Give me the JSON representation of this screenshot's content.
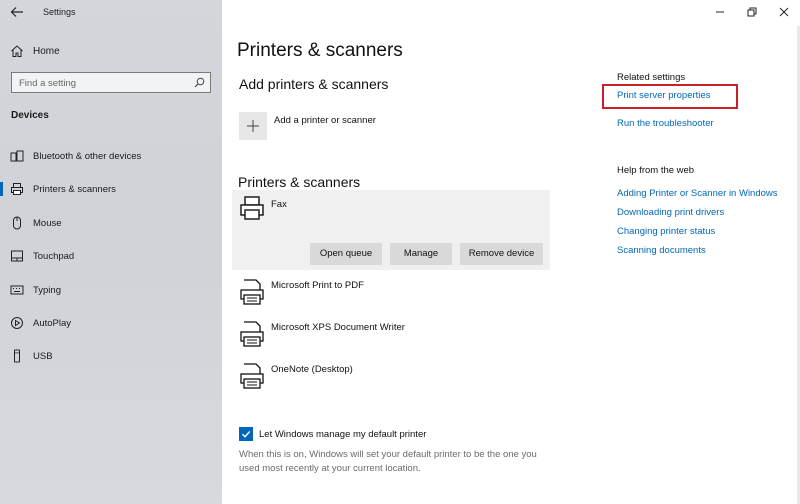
{
  "window": {
    "app_title": "Settings",
    "controls": [
      "minimize-icon",
      "restore-icon",
      "close-icon"
    ]
  },
  "sidebar": {
    "home_label": "Home",
    "search_placeholder": "Find a setting",
    "section_label": "Devices",
    "items": [
      {
        "label": "Bluetooth & other devices",
        "icon": "bluetooth-devices-icon",
        "active": false
      },
      {
        "label": "Printers & scanners",
        "icon": "printer-icon",
        "active": true
      },
      {
        "label": "Mouse",
        "icon": "mouse-icon",
        "active": false
      },
      {
        "label": "Touchpad",
        "icon": "touchpad-icon",
        "active": false
      },
      {
        "label": "Typing",
        "icon": "keyboard-icon",
        "active": false
      },
      {
        "label": "AutoPlay",
        "icon": "autoplay-icon",
        "active": false
      },
      {
        "label": "USB",
        "icon": "usb-icon",
        "active": false
      }
    ]
  },
  "main": {
    "page_title": "Printers & scanners",
    "add_heading": "Add printers & scanners",
    "add_label": "Add a printer or scanner",
    "list_heading": "Printers & scanners",
    "printers": [
      {
        "name": "Fax",
        "selected": true
      },
      {
        "name": "Microsoft Print to PDF",
        "selected": false
      },
      {
        "name": "Microsoft XPS Document Writer",
        "selected": false
      },
      {
        "name": "OneNote (Desktop)",
        "selected": false
      }
    ],
    "selected_actions": {
      "open_queue": "Open queue",
      "manage": "Manage",
      "remove_device": "Remove device"
    },
    "default_printer": {
      "checked": true,
      "label": "Let Windows manage my default printer",
      "description": "When this is on, Windows will set your default printer to be the one you used most recently at your current location."
    }
  },
  "related": {
    "heading": "Related settings",
    "links": [
      "Print server properties",
      "Run the troubleshooter"
    ]
  },
  "help": {
    "heading": "Help from the web",
    "links": [
      "Adding Printer or Scanner in Windows",
      "Downloading print drivers",
      "Changing printer status",
      "Scanning documents"
    ]
  },
  "colors": {
    "accent": "#0067b8",
    "highlight": "#cc1f2d",
    "sidebar_bg": "#d3d6da"
  }
}
